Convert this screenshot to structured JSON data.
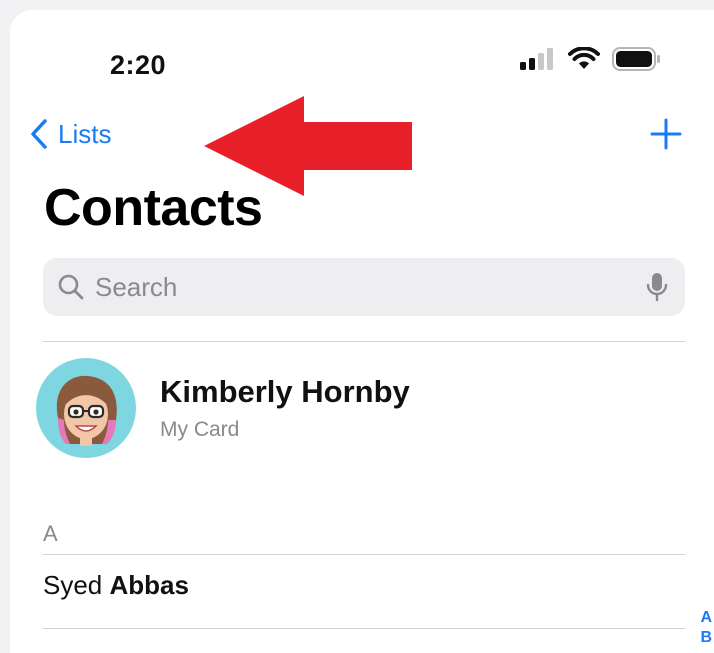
{
  "status_bar": {
    "time": "2:20",
    "icons": [
      "cellular-signal-icon",
      "wifi-icon",
      "battery-icon"
    ]
  },
  "nav": {
    "back_label": "Lists",
    "back_icon": "chevron-left-icon",
    "add_icon": "plus-icon"
  },
  "annotation": {
    "icon": "red-arrow-pointing-left",
    "color": "#e8202a"
  },
  "page": {
    "title": "Contacts"
  },
  "search": {
    "placeholder": "Search",
    "value": "",
    "icon": "search-icon",
    "mic_icon": "microphone-icon"
  },
  "my_card": {
    "name": "Kimberly Hornby",
    "subtitle": "My Card",
    "avatar": "memoji-avatar"
  },
  "sections": [
    {
      "header": "A",
      "contacts": [
        {
          "first": "Syed",
          "last": "Abbas"
        }
      ]
    }
  ],
  "index": [
    "A",
    "B"
  ],
  "colors": {
    "accent": "#1a7cf4",
    "arrow": "#e8202a",
    "avatar_bg": "#7ed7e0",
    "search_bg": "#eeeef0"
  }
}
